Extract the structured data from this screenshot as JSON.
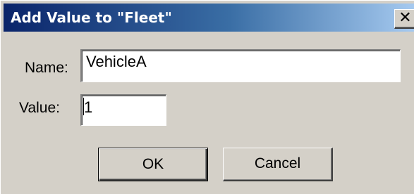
{
  "dialog": {
    "title": "Add Value to \"Fleet\"",
    "close_glyph": "✕"
  },
  "form": {
    "name_label": "Name:",
    "name_value": "VehicleA",
    "value_label": "Value:",
    "value_value": "1"
  },
  "buttons": {
    "ok_label": "OK",
    "cancel_label": "Cancel"
  },
  "icons": {
    "close": "close-icon"
  },
  "colors": {
    "title_start": "#0a246a",
    "title_end": "#a6caf0",
    "face": "#d4d0c8"
  }
}
